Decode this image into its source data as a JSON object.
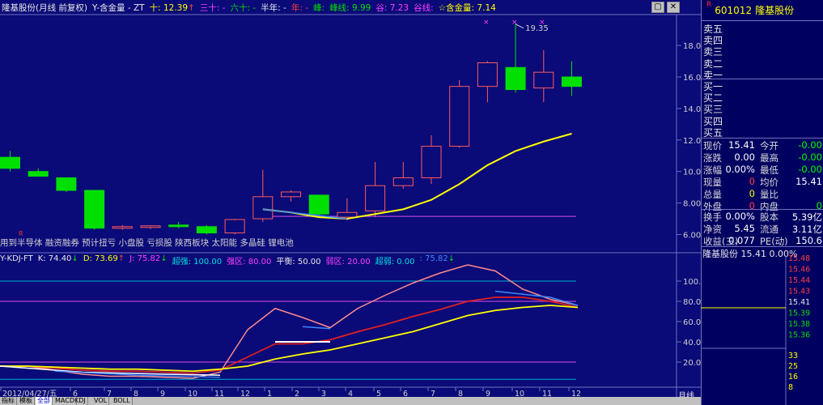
{
  "header": {
    "title": "隆基股份(月线 前复权)",
    "indicator_name": "Y-含金量 - ZT",
    "shi_label": "十:",
    "shi_value": "12.39",
    "shi_arrow": "↑",
    "sanshi": "三十: -",
    "liushi": "六十: -",
    "bannian": "半年: -",
    "nian": "年: -",
    "feng_label": "峰:",
    "feng_value": "峰线: 9.99",
    "gu_value": "谷: 7.23",
    "guxian": "谷线:",
    "hanjinliang": "☆含金量: 7.14"
  },
  "window_controls": [
    "▢",
    "✕"
  ],
  "main_chart": {
    "y_ticks": [
      "18.00",
      "16.00",
      "14.00",
      "12.00",
      "10.00",
      "8.00",
      "6.00"
    ],
    "high_annotation": "19.35",
    "bottom_labels": "用到半导体 融资融券 预计扭亏 小盘股 亏损股 陕西板块 太阳能 多晶硅 锂电池",
    "r_marker": "R",
    "candles": [
      {
        "o": 10.9,
        "h": 11.3,
        "l": 10.0,
        "c": 10.2
      },
      {
        "o": 10.0,
        "h": 10.2,
        "l": 9.7,
        "c": 9.7
      },
      {
        "o": 9.6,
        "h": 9.6,
        "l": 8.7,
        "c": 8.8
      },
      {
        "o": 8.8,
        "h": 8.8,
        "l": 6.3,
        "c": 6.4
      },
      {
        "o": 6.4,
        "h": 6.6,
        "l": 6.3,
        "c": 6.5
      },
      {
        "o": 6.45,
        "h": 6.6,
        "l": 6.35,
        "c": 6.55
      },
      {
        "o": 6.6,
        "h": 6.8,
        "l": 6.4,
        "c": 6.5
      },
      {
        "o": 6.5,
        "h": 6.6,
        "l": 6.0,
        "c": 6.1
      },
      {
        "o": 6.1,
        "h": 7.0,
        "l": 6.0,
        "c": 6.95
      },
      {
        "o": 7.0,
        "h": 10.1,
        "l": 6.8,
        "c": 8.4
      },
      {
        "o": 8.4,
        "h": 8.8,
        "l": 8.1,
        "c": 8.7
      },
      {
        "o": 8.5,
        "h": 8.5,
        "l": 7.2,
        "c": 7.3
      },
      {
        "o": 7.1,
        "h": 8.3,
        "l": 6.9,
        "c": 7.4
      },
      {
        "o": 7.5,
        "h": 10.6,
        "l": 7.1,
        "c": 9.1
      },
      {
        "o": 9.1,
        "h": 10.6,
        "l": 8.9,
        "c": 9.6
      },
      {
        "o": 9.6,
        "h": 12.3,
        "l": 9.2,
        "c": 11.6
      },
      {
        "o": 11.6,
        "h": 15.8,
        "l": 11.5,
        "c": 15.4
      },
      {
        "o": 15.4,
        "h": 17.0,
        "l": 14.4,
        "c": 16.9
      },
      {
        "o": 16.6,
        "h": 19.35,
        "l": 15.0,
        "c": 15.2
      },
      {
        "o": 15.3,
        "h": 17.7,
        "l": 14.4,
        "c": 16.3
      },
      {
        "o": 16.0,
        "h": 17.0,
        "l": 14.8,
        "c": 15.4
      }
    ],
    "ma_line": [
      7.6,
      7.4,
      7.1,
      7.0,
      7.3,
      7.6,
      8.2,
      9.2,
      10.4,
      11.3,
      11.9,
      12.4
    ],
    "ma_start_index": 9,
    "purple_level": 7.15,
    "blue_segment": [
      [
        9,
        7.6
      ],
      [
        12,
        7.0
      ]
    ]
  },
  "kdj": {
    "title": "Y-KDJ-FT",
    "k": "K: 74.40",
    "k_arrow": "↓",
    "d": "D: 73.69",
    "d_arrow": "↑",
    "j": "J: 75.82",
    "j_arrow": "↓",
    "chaoqiang": "超强: 100.00",
    "qiangqu": "强区: 80.00",
    "pingheng": "平衡: 50.00",
    "ruoqu": "弱区: 20.00",
    "chaoruo": "超弱: 0.00",
    "last": ": 75.82",
    "last_arrow": "↓",
    "y_ticks": [
      "100.0",
      "80.00",
      "60.00",
      "40.00",
      "20.00"
    ],
    "levels": {
      "cyan_top": 100,
      "magenta": 80,
      "magenta_low": 20,
      "cyan_bottom": 3
    },
    "k_line": [
      16,
      16,
      14,
      12,
      11,
      11,
      10,
      9,
      12,
      25,
      38,
      38,
      42,
      50,
      57,
      65,
      72,
      80,
      84,
      84,
      80,
      74
    ],
    "d_line": [
      16,
      16,
      15,
      14,
      13,
      13,
      12,
      11,
      13,
      16,
      23,
      28,
      32,
      38,
      44,
      50,
      58,
      66,
      71,
      74,
      76,
      74
    ],
    "j_line": [
      16,
      16,
      12,
      8,
      6,
      6,
      5,
      4,
      10,
      52,
      73,
      64,
      54,
      73,
      86,
      98,
      108,
      116,
      110,
      92,
      82,
      76
    ],
    "white_segment": [
      [
        10,
        40
      ],
      [
        12,
        40
      ]
    ],
    "blue_segment": [
      [
        11,
        55
      ],
      [
        12,
        53
      ]
    ],
    "blue_tail": [
      [
        18,
        90
      ],
      [
        20,
        84
      ],
      [
        21,
        76
      ]
    ],
    "x_labels": [
      "2012/04/27/五",
      "6",
      "7",
      "8",
      "9",
      "10",
      "11",
      "12",
      "1",
      "2",
      "3",
      "4",
      "5",
      "6",
      "7",
      "8",
      "9",
      "10",
      "11",
      "12"
    ],
    "period_label": "月线"
  },
  "bottom_tabs": [
    "指标",
    "模板",
    "全部",
    "MACD",
    "KDJ",
    "VOL",
    "BOLL"
  ],
  "side_panel": {
    "code": "601012",
    "name": "隆基股份",
    "r_mark": "R",
    "order_book": [
      "卖五",
      "卖四",
      "卖三",
      "卖二",
      "卖一",
      "买一",
      "买二",
      "买三",
      "买四",
      "买五"
    ],
    "quotes": [
      {
        "l1": "现价",
        "v1": "15.41",
        "c1": "w",
        "l2": "今开",
        "v2": "-0.00",
        "c2": "g"
      },
      {
        "l1": "涨跌",
        "v1": "0.00",
        "c1": "w",
        "l2": "最高",
        "v2": "-0.00",
        "c2": "g"
      },
      {
        "l1": "涨幅",
        "v1": "0.00%",
        "c1": "w",
        "l2": "最低",
        "v2": "-0.00",
        "c2": "g"
      },
      {
        "l1": "现量",
        "v1": "0",
        "c1": "r",
        "l2": "均价",
        "v2": "15.41",
        "c2": "w"
      },
      {
        "l1": "总量",
        "v1": "0",
        "c1": "y",
        "l2": "量比",
        "v2": "",
        "c2": "w"
      },
      {
        "l1": "外盘",
        "v1": "0",
        "c1": "r",
        "l2": "内盘",
        "v2": "0",
        "c2": "g"
      }
    ],
    "fundamentals": [
      {
        "l1": "换手",
        "v1": "0.00%",
        "l2": "股本",
        "v2": "5.39亿"
      },
      {
        "l1": "净资",
        "v1": "5.45",
        "l2": "流通",
        "v2": "3.11亿"
      },
      {
        "l1": "收益(三)",
        "v1": "0.077",
        "l2": "PE(动)",
        "v2": "150.6"
      }
    ],
    "mini_title": "隆基股份  15.41  0.00%",
    "mini_ticks": [
      {
        "v": "15.48",
        "c": "#ff4040"
      },
      {
        "v": "15.46",
        "c": "#ff4040"
      },
      {
        "v": "15.44",
        "c": "#ff4040"
      },
      {
        "v": "15.43",
        "c": "#ff4040"
      },
      {
        "v": "15.41",
        "c": "#e8e8e8"
      },
      {
        "v": "15.39",
        "c": "#00e000"
      },
      {
        "v": "15.38",
        "c": "#00e000"
      },
      {
        "v": "15.36",
        "c": "#00e000"
      },
      {
        "v": "33",
        "c": "#ffff00"
      },
      {
        "v": "25",
        "c": "#ffff00"
      },
      {
        "v": "16",
        "c": "#ffff00"
      },
      {
        "v": "8",
        "c": "#ffff00"
      }
    ]
  }
}
